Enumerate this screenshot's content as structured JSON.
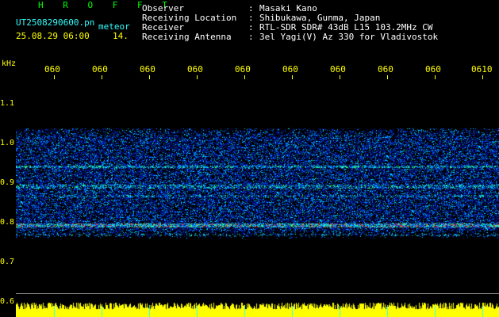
{
  "header": {
    "title": "H R O F F T",
    "file_name": "UT2508290600.pn",
    "meteor_label": "meteor",
    "datetime": "25.08.29 06:00",
    "count": "14."
  },
  "metadata": [
    {
      "label": "Observer",
      "sep": ":",
      "value": "Masaki Kano"
    },
    {
      "label": "Receiving Location",
      "sep": ":",
      "value": "Shibukawa, Gunma, Japan"
    },
    {
      "label": "Receiver",
      "sep": ":",
      "value": "RTL-SDR SDR# 43dB L15 103.2MHz CW"
    },
    {
      "label": "Receiving Antenna",
      "sep": ":",
      "value": "3el Yagi(V) Az 330 for Vladivostok"
    }
  ],
  "axis": {
    "y_unit": "kHz",
    "y_ticks": [
      "1.1",
      "1.0",
      "0.9",
      "0.8",
      "0.7",
      "0.6"
    ],
    "x_ticks": [
      "060",
      "060",
      "060",
      "060",
      "060",
      "060",
      "060",
      "060",
      "060",
      "0610"
    ]
  },
  "colors": {
    "background": "#000000",
    "title": "#00ff00",
    "meta_text": "#ffffff",
    "axis_text": "#ffff00",
    "file_text": "#33ffff",
    "signal_low": "#0022aa",
    "signal_mid": "#00aaff",
    "signal_high": "#ff2200",
    "level_bars": "#ffff00"
  }
}
